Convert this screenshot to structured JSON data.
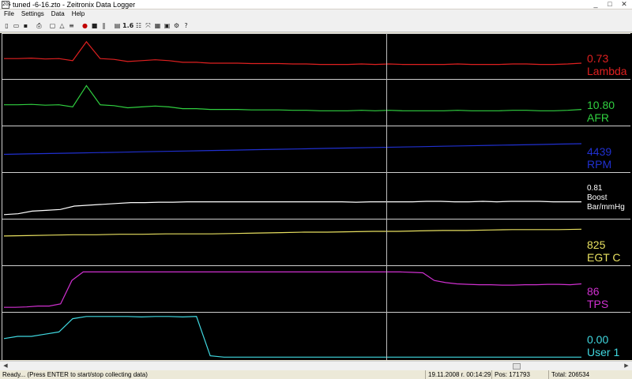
{
  "window": {
    "icon_text": "20s",
    "title": "tuned -6-16.zto - Zeitronix Data Logger",
    "controls": [
      "_",
      "□",
      "✕"
    ]
  },
  "menu": [
    "File",
    "Settings",
    "Data",
    "Help"
  ],
  "toolbar": {
    "buttons": [
      "new-icon",
      "open-icon",
      "save-icon",
      "print-icon",
      "view-icon",
      "warning-icon",
      "scale-icon",
      "record-icon",
      "stop-icon",
      "pause-icon",
      "grid-icon",
      "zoom-value-icon",
      "channels-icon",
      "fit-icon",
      "export-icon",
      "image-icon",
      "settings-icon",
      "help-icon"
    ],
    "zoom_text": "1.6"
  },
  "channels": [
    {
      "key": "lambda",
      "value": "0.73",
      "label": "Lambda",
      "color": "#e02020",
      "trace": [
        0.55,
        0.55,
        0.54,
        0.56,
        0.55,
        0.6,
        0.15,
        0.55,
        0.57,
        0.62,
        0.6,
        0.58,
        0.6,
        0.64,
        0.64,
        0.66,
        0.66,
        0.66,
        0.67,
        0.67,
        0.67,
        0.68,
        0.68,
        0.69,
        0.69,
        0.69,
        0.68,
        0.69,
        0.68,
        0.69,
        0.69,
        0.69,
        0.69,
        0.68,
        0.69,
        0.69,
        0.69,
        0.68,
        0.68,
        0.69,
        0.69,
        0.68,
        0.66
      ]
    },
    {
      "key": "afr",
      "value": "10.80",
      "label": "AFR",
      "color": "#30d040",
      "trace": [
        0.55,
        0.55,
        0.54,
        0.56,
        0.55,
        0.6,
        0.1,
        0.55,
        0.57,
        0.62,
        0.6,
        0.58,
        0.6,
        0.64,
        0.64,
        0.66,
        0.66,
        0.66,
        0.67,
        0.67,
        0.67,
        0.68,
        0.68,
        0.69,
        0.69,
        0.69,
        0.68,
        0.69,
        0.68,
        0.69,
        0.69,
        0.69,
        0.69,
        0.68,
        0.69,
        0.69,
        0.69,
        0.68,
        0.68,
        0.69,
        0.69,
        0.68,
        0.66
      ]
    },
    {
      "key": "rpm",
      "value": "4439",
      "label": "RPM",
      "color": "#2030d0",
      "trace": [
        0.62,
        0.61,
        0.6,
        0.59,
        0.58,
        0.57,
        0.56,
        0.55,
        0.54,
        0.53,
        0.52,
        0.51,
        0.5,
        0.49,
        0.48,
        0.47,
        0.46,
        0.45,
        0.44,
        0.43,
        0.42,
        0.41,
        0.4,
        0.39,
        0.38,
        0.37
      ]
    },
    {
      "key": "boost",
      "value": "0.81",
      "label": "Boost",
      "unit": "Bar/mmHg",
      "color": "#ffffff",
      "small": true,
      "trace": [
        0.94,
        0.92,
        0.86,
        0.84,
        0.82,
        0.74,
        0.72,
        0.7,
        0.68,
        0.66,
        0.66,
        0.65,
        0.65,
        0.64,
        0.64,
        0.64,
        0.64,
        0.64,
        0.64,
        0.64,
        0.64,
        0.64,
        0.64,
        0.64,
        0.64,
        0.65,
        0.64,
        0.64,
        0.64,
        0.64,
        0.63,
        0.63,
        0.64,
        0.64,
        0.63,
        0.64,
        0.63,
        0.63,
        0.63,
        0.64,
        0.64,
        0.64
      ]
    },
    {
      "key": "egt",
      "value": "825",
      "label": "EGT C",
      "color": "#e8e060",
      "trace": [
        0.35,
        0.34,
        0.33,
        0.32,
        0.32,
        0.31,
        0.31,
        0.3,
        0.3,
        0.3,
        0.29,
        0.28,
        0.27,
        0.26,
        0.26,
        0.25,
        0.24,
        0.24,
        0.23,
        0.22,
        0.22,
        0.21,
        0.2,
        0.2,
        0.2,
        0.19
      ]
    },
    {
      "key": "tps",
      "value": "86",
      "label": "TPS",
      "color": "#d030d0",
      "trace": [
        0.93,
        0.93,
        0.92,
        0.9,
        0.9,
        0.85,
        0.3,
        0.1,
        0.1,
        0.1,
        0.1,
        0.1,
        0.1,
        0.1,
        0.1,
        0.1,
        0.1,
        0.1,
        0.1,
        0.1,
        0.1,
        0.1,
        0.1,
        0.1,
        0.1,
        0.1,
        0.1,
        0.1,
        0.1,
        0.1,
        0.1,
        0.1,
        0.1,
        0.1,
        0.1,
        0.1,
        0.11,
        0.12,
        0.3,
        0.35,
        0.38,
        0.39,
        0.4,
        0.4,
        0.41,
        0.41,
        0.4,
        0.4,
        0.39,
        0.39,
        0.4,
        0.38
      ]
    },
    {
      "key": "user1",
      "value": "0.00",
      "label": "User 1",
      "color": "#40d8e0",
      "trace": [
        0.55,
        0.5,
        0.5,
        0.45,
        0.4,
        0.1,
        0.05,
        0.05,
        0.05,
        0.05,
        0.06,
        0.05,
        0.05,
        0.06,
        0.05,
        0.94,
        0.97,
        0.97,
        0.97,
        0.97,
        0.97,
        0.97,
        0.97,
        0.97,
        0.97,
        0.97,
        0.97,
        0.97,
        0.97,
        0.97,
        0.97,
        0.97,
        0.97,
        0.97,
        0.97,
        0.97,
        0.97,
        0.97,
        0.97,
        0.97,
        0.97,
        0.97,
        0.97
      ]
    }
  ],
  "status": {
    "message": "Ready... (Press ENTER to start/stop collecting data)",
    "datetime": "19.11.2008 r. 00:14:29",
    "position": "Pos: 171793",
    "total": "Total: 206534"
  },
  "scrollbar": {
    "position": 0.83
  }
}
